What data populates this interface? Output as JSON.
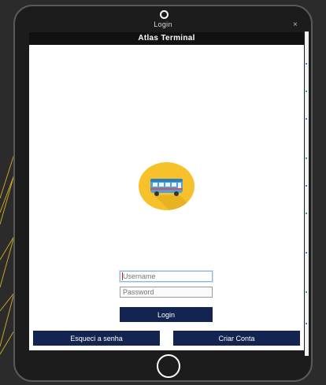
{
  "window": {
    "title": "Login",
    "close_symbol": "×"
  },
  "app": {
    "header_title": "Atlas Terminal",
    "logo_icon": "bus-icon"
  },
  "form": {
    "username_placeholder": "Username",
    "password_placeholder": "Password",
    "login_label": "Login",
    "forgot_label": "Esqueci a senha",
    "create_label": "Criar Conta"
  },
  "colors": {
    "background": "#2b2b2b",
    "accent_lines": "#c9a227",
    "header": "#111111",
    "button": "#132451",
    "logo_circle": "#f6c12a",
    "bus_body": "#4aa3e0"
  }
}
